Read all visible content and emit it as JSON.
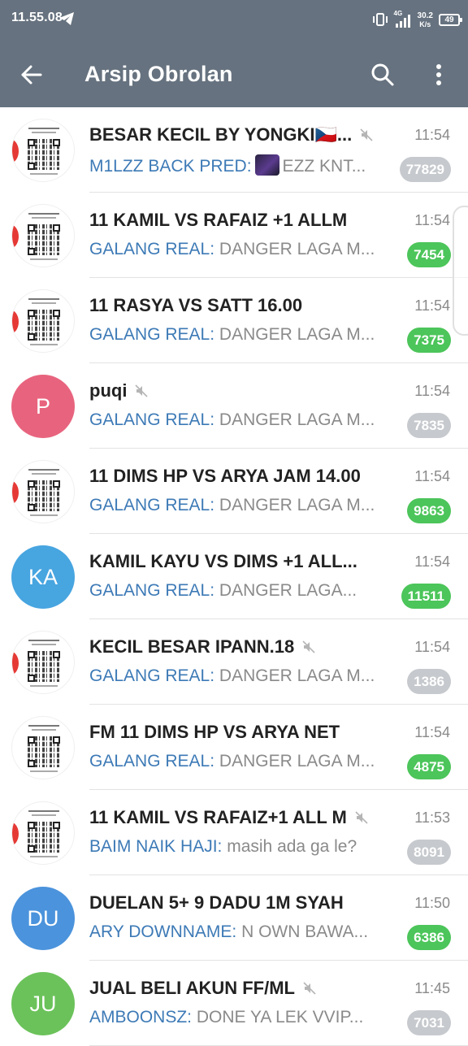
{
  "status_bar": {
    "time": "11.55.08",
    "network_type": "4G",
    "speed_value": "30.2",
    "speed_unit": "K/s",
    "battery": "49"
  },
  "app_bar": {
    "title": "Arsip Obrolan",
    "back_icon": "arrow-left-icon",
    "search_icon": "search-icon",
    "more_icon": "more-vertical-icon"
  },
  "colors": {
    "header": "#66727f",
    "sender": "#3d7ab6",
    "badge_unmuted": "#4cc55a",
    "badge_muted": "#c6c9cd"
  },
  "chats": [
    {
      "name": "BESAR KECIL BY YONGKI🇨🇿...",
      "muted": true,
      "time": "11:54",
      "sender": "M1LZZ BACK PRED:",
      "has_thumb": true,
      "message": "EZZ KNT...",
      "unread": "77829",
      "avatar": {
        "type": "qr"
      }
    },
    {
      "name": "11 KAMIL VS RAFAIZ +1 ALLM",
      "muted": false,
      "time": "11:54",
      "sender": "GALANG REAL:",
      "has_thumb": false,
      "message": "DANGER LAGA M...",
      "unread": "7454",
      "avatar": {
        "type": "qr"
      }
    },
    {
      "name": "11 RASYA VS SATT 16.00",
      "muted": false,
      "time": "11:54",
      "sender": "GALANG REAL:",
      "has_thumb": false,
      "message": "DANGER LAGA M...",
      "unread": "7375",
      "avatar": {
        "type": "qr"
      }
    },
    {
      "name": "puqi",
      "muted": true,
      "time": "11:54",
      "sender": "GALANG REAL:",
      "has_thumb": false,
      "message": "DANGER LAGA M...",
      "unread": "7835",
      "avatar": {
        "type": "initials",
        "text": "P",
        "color": "#e8647e"
      }
    },
    {
      "name": "11 DIMS HP VS ARYA JAM 14.00",
      "muted": false,
      "time": "11:54",
      "sender": "GALANG REAL:",
      "has_thumb": false,
      "message": "DANGER LAGA M...",
      "unread": "9863",
      "avatar": {
        "type": "qr"
      }
    },
    {
      "name": "KAMIL KAYU VS DIMS +1 ALL...",
      "muted": false,
      "time": "11:54",
      "sender": "GALANG REAL:",
      "has_thumb": false,
      "message": "DANGER LAGA...",
      "unread": "11511",
      "avatar": {
        "type": "initials",
        "text": "KA",
        "color": "#47a5e0"
      }
    },
    {
      "name": "KECIL BESAR IPANN.18",
      "muted": true,
      "time": "11:54",
      "sender": "GALANG REAL:",
      "has_thumb": false,
      "message": "DANGER LAGA M...",
      "unread": "1386",
      "avatar": {
        "type": "qr"
      }
    },
    {
      "name": "FM 11 DIMS HP VS ARYA NET",
      "muted": false,
      "time": "11:54",
      "sender": "GALANG REAL:",
      "has_thumb": false,
      "message": "DANGER LAGA M...",
      "unread": "4875",
      "avatar": {
        "type": "qr-plain"
      }
    },
    {
      "name": "11 KAMIL VS RAFAIZ+1 ALL M",
      "muted": true,
      "time": "11:53",
      "sender": "BAIM NAIK HAJI:",
      "has_thumb": false,
      "message": "masih ada ga le?",
      "unread": "8091",
      "avatar": {
        "type": "qr"
      }
    },
    {
      "name": "DUELAN 5+ 9 DADU 1M SYAH",
      "muted": false,
      "time": "11:50",
      "sender": "ARY DOWNNAME:",
      "has_thumb": false,
      "message": "N OWN BAWA...",
      "unread": "6386",
      "avatar": {
        "type": "initials",
        "text": "DU",
        "color": "#4b93dc"
      }
    },
    {
      "name": "JUAL BELI AKUN FF/ML",
      "muted": true,
      "time": "11:45",
      "sender": "AMBOONSZ:",
      "has_thumb": false,
      "message": "DONE YA LEK VVIP...",
      "unread": "7031",
      "avatar": {
        "type": "initials",
        "text": "JU",
        "color": "#6bc25a"
      }
    }
  ]
}
